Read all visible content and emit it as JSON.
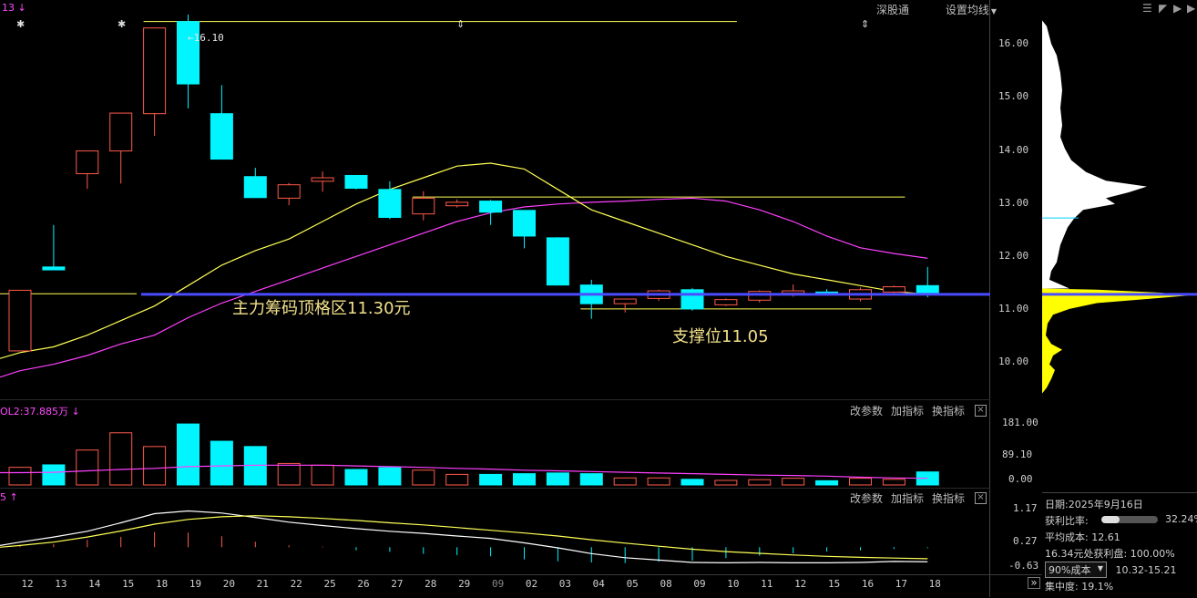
{
  "top_left_label": "13",
  "top_menu": {
    "shengutong": "深股通",
    "set_ma": "设置均线"
  },
  "max_label": "16.10",
  "annotations": {
    "resistance": "主力筹码顶格区11.30元",
    "support": "支撑位11.05"
  },
  "price_axis": [
    "16.00",
    "15.00",
    "14.00",
    "13.00",
    "12.00",
    "11.00",
    "10.00"
  ],
  "volume_panel": {
    "title": "OL2:37.885万",
    "axis": [
      "181.00",
      "89.10",
      "0.00"
    ]
  },
  "indicator_panel": {
    "title": "5",
    "axis": [
      "1.17",
      "0.27",
      "-0.63"
    ]
  },
  "panel_buttons": {
    "change_params": "改参数",
    "add_indicator": "加指标",
    "switch_indicator": "换指标"
  },
  "dates": [
    "12",
    "13",
    "14",
    "15",
    "18",
    "19",
    "20",
    "21",
    "22",
    "25",
    "26",
    "27",
    "28",
    "29",
    "09",
    "02",
    "03",
    "04",
    "05",
    "08",
    "09",
    "10",
    "11",
    "12",
    "15",
    "16",
    "17",
    "18"
  ],
  "info": {
    "date_label": "日期:",
    "date_value": "2025年9月16日",
    "profit_ratio_label": "获利比率:",
    "profit_ratio_value": "32.24%",
    "profit_ratio": 0.3224,
    "avg_cost_label": "平均成本:",
    "avg_cost_value": "12.61",
    "profit_at_label": "16.34元处获利盘:",
    "profit_at_value": "100.00%",
    "cost_select": "90%成本",
    "cost_range": "10.32-15.21",
    "concentration_label": "集中度:",
    "concentration_value": "19.1%"
  },
  "colors": {
    "up": "#ff5a4a",
    "down": "#00f5ff",
    "ma_yellow": "#ffff55",
    "ma_magenta": "#ff40ff",
    "blue_line": "#4b4bff"
  },
  "chart_data": {
    "type": "candlestick",
    "categories": [
      "12",
      "13",
      "14",
      "15",
      "18",
      "19",
      "20",
      "21",
      "22",
      "25",
      "26",
      "27",
      "28",
      "29",
      "09",
      "02",
      "03",
      "04",
      "05",
      "08",
      "09",
      "10",
      "11",
      "12",
      "15",
      "16",
      "17",
      "18"
    ],
    "ohlc": [
      [
        10.33,
        11.37,
        10.33,
        11.37
      ],
      [
        11.77,
        12.49,
        11.72,
        11.72
      ],
      [
        13.37,
        13.76,
        13.11,
        13.76
      ],
      [
        13.76,
        14.41,
        13.2,
        14.41
      ],
      [
        14.4,
        15.87,
        14.02,
        15.87
      ],
      [
        15.98,
        16.1,
        14.49,
        14.91
      ],
      [
        14.4,
        14.89,
        13.62,
        13.62
      ],
      [
        13.32,
        13.47,
        12.96,
        12.96
      ],
      [
        12.95,
        13.21,
        12.83,
        13.18
      ],
      [
        13.24,
        13.41,
        13.06,
        13.3
      ],
      [
        13.34,
        13.34,
        13.1,
        13.12
      ],
      [
        13.1,
        13.24,
        12.59,
        12.62
      ],
      [
        12.68,
        13.07,
        12.57,
        12.95
      ],
      [
        12.82,
        12.93,
        12.79,
        12.88
      ],
      [
        12.9,
        12.92,
        12.49,
        12.71
      ],
      [
        12.74,
        12.74,
        12.09,
        12.3
      ],
      [
        12.27,
        12.28,
        11.46,
        11.46
      ],
      [
        11.46,
        11.55,
        10.88,
        11.14
      ],
      [
        11.14,
        11.22,
        10.99,
        11.22
      ],
      [
        11.23,
        11.38,
        11.19,
        11.36
      ],
      [
        11.38,
        11.41,
        11.02,
        11.05
      ],
      [
        11.12,
        11.23,
        11.1,
        11.21
      ],
      [
        11.2,
        11.37,
        11.16,
        11.35
      ],
      [
        11.32,
        11.47,
        11.26,
        11.36
      ],
      [
        11.34,
        11.39,
        11.3,
        11.32
      ],
      [
        11.22,
        11.42,
        11.18,
        11.38
      ],
      [
        11.34,
        11.45,
        11.32,
        11.43
      ],
      [
        11.45,
        11.77,
        11.25,
        11.32
      ]
    ],
    "ma_yellow": [
      10.3,
      10.4,
      10.6,
      10.85,
      11.1,
      11.45,
      11.8,
      12.05,
      12.25,
      12.55,
      12.85,
      13.1,
      13.3,
      13.5,
      13.55,
      13.45,
      13.1,
      12.75,
      12.55,
      12.35,
      12.15,
      11.95,
      11.8,
      11.65,
      11.55,
      11.45,
      11.35,
      11.3
    ],
    "ma_magenta": [
      9.99,
      10.1,
      10.25,
      10.45,
      10.6,
      10.9,
      11.15,
      11.35,
      11.55,
      11.75,
      11.95,
      12.15,
      12.35,
      12.55,
      12.7,
      12.8,
      12.85,
      12.88,
      12.9,
      12.93,
      12.95,
      12.9,
      12.75,
      12.55,
      12.3,
      12.1,
      12.0,
      11.92
    ],
    "hlines": [
      {
        "from": 4,
        "to": 21,
        "value": 15.98
      },
      {
        "from": 12,
        "to": 26,
        "value": 12.97
      },
      {
        "from": 17,
        "to": 25,
        "value": 11.05
      }
    ],
    "support_line": 11.3,
    "ylim": [
      9.5,
      16.35
    ],
    "volume": [
      50,
      57,
      99,
      148,
      109,
      173,
      124,
      109,
      61,
      56,
      44,
      49,
      42,
      30,
      30,
      32,
      34,
      32,
      20,
      20,
      16,
      13,
      15,
      19,
      12,
      19,
      16,
      37
    ],
    "volume_ma": [
      35,
      36,
      40,
      44,
      47,
      52,
      54,
      56,
      56,
      56,
      54,
      52,
      50,
      47,
      45,
      42,
      40,
      38,
      36,
      34,
      32,
      30,
      28,
      27,
      25,
      22,
      20,
      19
    ],
    "volume_ylim": [
      0,
      181
    ],
    "macd_hist": [
      0.05,
      0.1,
      0.24,
      0.34,
      0.5,
      0.48,
      0.36,
      0.18,
      0.06,
      0.02,
      -0.1,
      -0.15,
      -0.22,
      -0.26,
      -0.3,
      -0.4,
      -0.46,
      -0.5,
      -0.52,
      -0.48,
      -0.44,
      -0.36,
      -0.28,
      -0.2,
      -0.14,
      -0.1,
      -0.06,
      -0.03
    ],
    "dif": [
      0.15,
      0.3,
      0.47,
      0.72,
      0.99,
      1.07,
      1.01,
      0.88,
      0.74,
      0.64,
      0.55,
      0.47,
      0.41,
      0.33,
      0.26,
      0.13,
      -0.02,
      -0.19,
      -0.31,
      -0.38,
      -0.45,
      -0.46,
      -0.45,
      -0.46,
      -0.46,
      -0.45,
      -0.42,
      -0.43
    ],
    "dea": [
      0.05,
      0.15,
      0.3,
      0.48,
      0.68,
      0.82,
      0.9,
      0.93,
      0.9,
      0.85,
      0.79,
      0.72,
      0.66,
      0.58,
      0.5,
      0.42,
      0.33,
      0.22,
      0.12,
      0.03,
      -0.06,
      -0.13,
      -0.18,
      -0.23,
      -0.27,
      -0.3,
      -0.32,
      -0.34
    ],
    "indicator_ylim": [
      -0.8,
      1.3
    ]
  }
}
